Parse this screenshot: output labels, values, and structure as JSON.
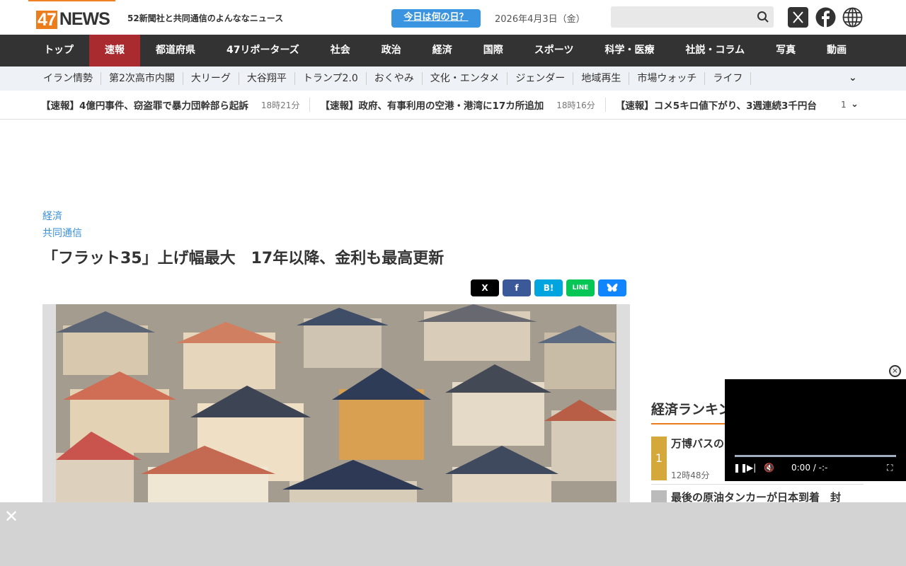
{
  "header": {
    "logo_num": "47",
    "logo_text": "NEWS",
    "tagline": "52新聞社と共同通信のよんななニュース",
    "today_button": "今日は何の日？",
    "date": "2026年4月3日（金）",
    "search_placeholder": ""
  },
  "nav": [
    "トップ",
    "速報",
    "都道府県",
    "47リポーターズ",
    "社会",
    "政治",
    "経済",
    "国際",
    "スポーツ",
    "科学・医療",
    "社説・コラム",
    "写真",
    "動画"
  ],
  "subnav": [
    "イラン情勢",
    "第2次高市内閣",
    "大リーグ",
    "大谷翔平",
    "トランプ2.0",
    "おくやみ",
    "文化・エンタメ",
    "ジェンダー",
    "地域再生",
    "市場ウォッチ",
    "ライフ"
  ],
  "ticker": {
    "items": [
      {
        "title": "【速報】4億円事件、窃盗罪で暴力団幹部ら起訴",
        "time": "18時21分"
      },
      {
        "title": "【速報】政府、有事利用の空港・港湾に17カ所追加",
        "time": "18時16分"
      },
      {
        "title": "【速報】コメ5キロ値下がり、3週連続3千円台",
        "time": ""
      }
    ],
    "page": "1"
  },
  "article": {
    "category": "経済",
    "source": "共同通信",
    "title": "「フラット35」上げ幅最大　17年以降、金利も最高更新",
    "share": [
      "X",
      "f",
      "B!",
      "LINE",
      "bluesky"
    ]
  },
  "ranking": {
    "title": "経済ランキング",
    "items": [
      {
        "rank": "1",
        "title": "万博バスの…相、転用断…",
        "time": "12時48分"
      },
      {
        "rank": "2",
        "title": "最後の原油タンカーが日本到着　封"
      }
    ]
  },
  "video": {
    "time": "0:00",
    "sep": "/",
    "duration": "-:-"
  },
  "colors": {
    "accent": "#ec7d1c",
    "active_nav": "#a92b2f",
    "link": "#3a8fd9"
  }
}
